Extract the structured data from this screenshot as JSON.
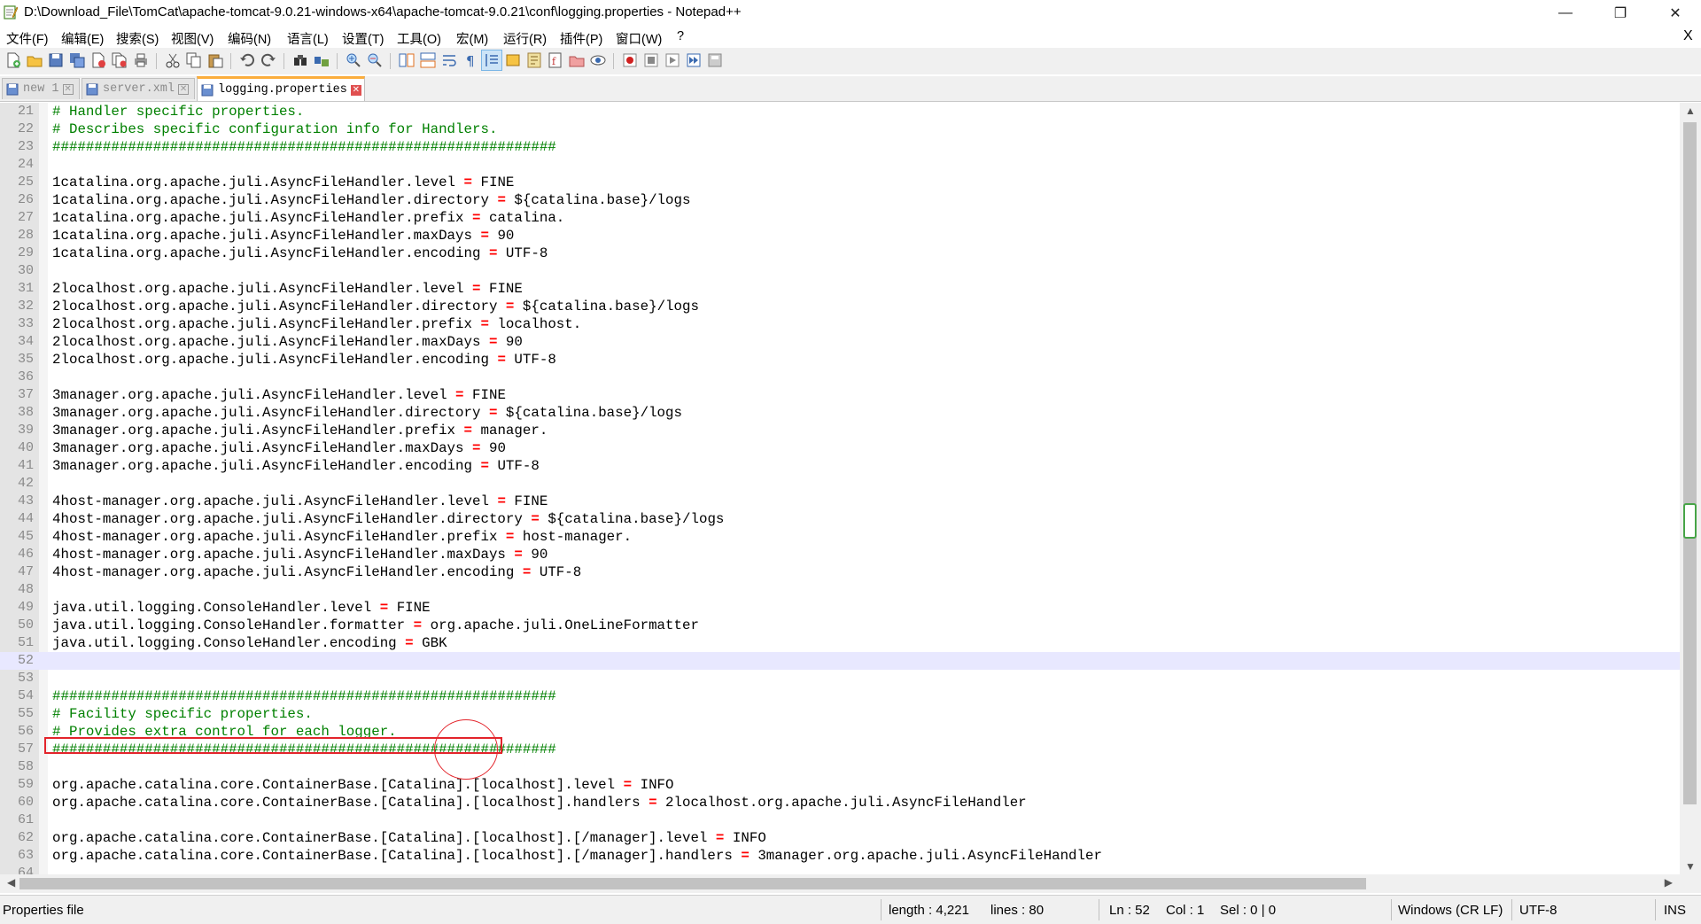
{
  "window": {
    "title": "D:\\Download_File\\TomCat\\apache-tomcat-9.0.21-windows-x64\\apache-tomcat-9.0.21\\conf\\logging.properties - Notepad++",
    "controls": {
      "minimize": "—",
      "maximize": "❐",
      "close": "✕"
    }
  },
  "menu": {
    "items": [
      "文件(F)",
      "编辑(E)",
      "搜索(S)",
      "视图(V)",
      "编码(N)",
      "语言(L)",
      "设置(T)",
      "工具(O)",
      "宏(M)",
      "运行(R)",
      "插件(P)",
      "窗口(W)",
      "?"
    ],
    "close_doc": "X"
  },
  "tabs": [
    {
      "label": "new 1",
      "active": false
    },
    {
      "label": "server.xml",
      "active": false
    },
    {
      "label": "logging.properties",
      "active": true
    }
  ],
  "editor": {
    "lines": [
      {
        "n": "21",
        "text": "# Handler specific properties.",
        "type": "comment"
      },
      {
        "n": "22",
        "text": "# Describes specific configuration info for Handlers.",
        "type": "comment"
      },
      {
        "n": "23",
        "text": "############################################################",
        "type": "comment"
      },
      {
        "n": "24",
        "text": "",
        "type": "blank"
      },
      {
        "n": "25",
        "key": "1catalina.org.apache.juli.AsyncFileHandler.level",
        "value": "FINE",
        "type": "prop"
      },
      {
        "n": "26",
        "key": "1catalina.org.apache.juli.AsyncFileHandler.directory",
        "value": "${catalina.base}/logs",
        "type": "prop"
      },
      {
        "n": "27",
        "key": "1catalina.org.apache.juli.AsyncFileHandler.prefix",
        "value": "catalina.",
        "type": "prop"
      },
      {
        "n": "28",
        "key": "1catalina.org.apache.juli.AsyncFileHandler.maxDays",
        "value": "90",
        "type": "prop"
      },
      {
        "n": "29",
        "key": "1catalina.org.apache.juli.AsyncFileHandler.encoding",
        "value": "UTF-8",
        "type": "prop"
      },
      {
        "n": "30",
        "text": "",
        "type": "blank"
      },
      {
        "n": "31",
        "key": "2localhost.org.apache.juli.AsyncFileHandler.level",
        "value": "FINE",
        "type": "prop"
      },
      {
        "n": "32",
        "key": "2localhost.org.apache.juli.AsyncFileHandler.directory",
        "value": "${catalina.base}/logs",
        "type": "prop"
      },
      {
        "n": "33",
        "key": "2localhost.org.apache.juli.AsyncFileHandler.prefix",
        "value": "localhost.",
        "type": "prop"
      },
      {
        "n": "34",
        "key": "2localhost.org.apache.juli.AsyncFileHandler.maxDays",
        "value": "90",
        "type": "prop"
      },
      {
        "n": "35",
        "key": "2localhost.org.apache.juli.AsyncFileHandler.encoding",
        "value": "UTF-8",
        "type": "prop"
      },
      {
        "n": "36",
        "text": "",
        "type": "blank"
      },
      {
        "n": "37",
        "key": "3manager.org.apache.juli.AsyncFileHandler.level",
        "value": "FINE",
        "type": "prop"
      },
      {
        "n": "38",
        "key": "3manager.org.apache.juli.AsyncFileHandler.directory",
        "value": "${catalina.base}/logs",
        "type": "prop"
      },
      {
        "n": "39",
        "key": "3manager.org.apache.juli.AsyncFileHandler.prefix",
        "value": "manager.",
        "type": "prop"
      },
      {
        "n": "40",
        "key": "3manager.org.apache.juli.AsyncFileHandler.maxDays",
        "value": "90",
        "type": "prop"
      },
      {
        "n": "41",
        "key": "3manager.org.apache.juli.AsyncFileHandler.encoding",
        "value": "UTF-8",
        "type": "prop"
      },
      {
        "n": "42",
        "text": "",
        "type": "blank"
      },
      {
        "n": "43",
        "key": "4host-manager.org.apache.juli.AsyncFileHandler.level",
        "value": "FINE",
        "type": "prop"
      },
      {
        "n": "44",
        "key": "4host-manager.org.apache.juli.AsyncFileHandler.directory",
        "value": "${catalina.base}/logs",
        "type": "prop"
      },
      {
        "n": "45",
        "key": "4host-manager.org.apache.juli.AsyncFileHandler.prefix",
        "value": "host-manager.",
        "type": "prop"
      },
      {
        "n": "46",
        "key": "4host-manager.org.apache.juli.AsyncFileHandler.maxDays",
        "value": "90",
        "type": "prop"
      },
      {
        "n": "47",
        "key": "4host-manager.org.apache.juli.AsyncFileHandler.encoding",
        "value": "UTF-8",
        "type": "prop"
      },
      {
        "n": "48",
        "text": "",
        "type": "blank"
      },
      {
        "n": "49",
        "key": "java.util.logging.ConsoleHandler.level",
        "value": "FINE",
        "type": "prop"
      },
      {
        "n": "50",
        "key": "java.util.logging.ConsoleHandler.formatter",
        "value": "org.apache.juli.OneLineFormatter",
        "type": "prop"
      },
      {
        "n": "51",
        "key": "java.util.logging.ConsoleHandler.encoding",
        "value": "GBK",
        "type": "prop"
      },
      {
        "n": "52",
        "text": "",
        "type": "blank",
        "current": true
      },
      {
        "n": "53",
        "text": "",
        "type": "blank"
      },
      {
        "n": "54",
        "text": "############################################################",
        "type": "comment"
      },
      {
        "n": "55",
        "text": "# Facility specific properties.",
        "type": "comment"
      },
      {
        "n": "56",
        "text": "# Provides extra control for each logger.",
        "type": "comment"
      },
      {
        "n": "57",
        "text": "############################################################",
        "type": "comment"
      },
      {
        "n": "58",
        "text": "",
        "type": "blank"
      },
      {
        "n": "59",
        "key": "org.apache.catalina.core.ContainerBase.[Catalina].[localhost].level",
        "value": "INFO",
        "type": "prop"
      },
      {
        "n": "60",
        "key": "org.apache.catalina.core.ContainerBase.[Catalina].[localhost].handlers",
        "value": "2localhost.org.apache.juli.AsyncFileHandler",
        "type": "prop"
      },
      {
        "n": "61",
        "text": "",
        "type": "blank"
      },
      {
        "n": "62",
        "key": "org.apache.catalina.core.ContainerBase.[Catalina].[localhost].[/manager].level",
        "value": "INFO",
        "type": "prop"
      },
      {
        "n": "63",
        "key": "org.apache.catalina.core.ContainerBase.[Catalina].[localhost].[/manager].handlers",
        "value": "3manager.org.apache.juli.AsyncFileHandler",
        "type": "prop"
      },
      {
        "n": "64",
        "text": "",
        "type": "blank"
      }
    ],
    "equals": "=",
    "colors": {
      "comment": "#008000",
      "operator": "#ff0000",
      "annotation": "#e3242b",
      "current_line": "#e8e8ff"
    }
  },
  "statusbar": {
    "filetype": "Properties file",
    "length": "length : 4,221",
    "lines": "lines : 80",
    "ln": "Ln : 52",
    "col": "Col : 1",
    "sel": "Sel : 0 | 0",
    "eol": "Windows (CR LF)",
    "encoding": "UTF-8",
    "mode": "INS"
  },
  "icons": [
    "new-file-icon",
    "open-file-icon",
    "save-icon",
    "save-all-icon",
    "close-icon",
    "close-all-icon",
    "print-icon",
    "cut-icon",
    "copy-icon",
    "paste-icon",
    "undo-icon",
    "redo-icon",
    "find-icon",
    "replace-icon",
    "zoom-in-icon",
    "zoom-out-icon",
    "sync-vertical-icon",
    "sync-horizontal-icon",
    "word-wrap-icon",
    "show-all-chars-icon",
    "indent-guide-icon",
    "udl-icon",
    "doc-map-icon",
    "function-list-icon",
    "folder-workspace-icon",
    "monitoring-icon",
    "record-macro-icon",
    "stop-record-icon",
    "play-macro-icon",
    "run-macro-multiple-icon",
    "save-macro-icon"
  ]
}
